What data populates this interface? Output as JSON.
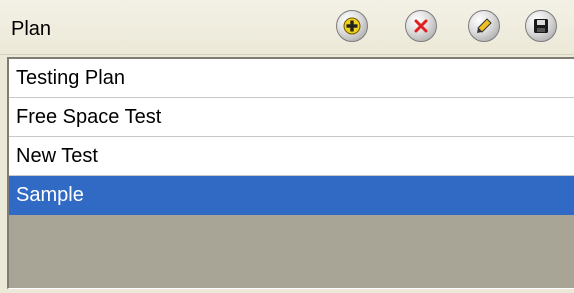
{
  "panel": {
    "title": "Plan",
    "toolbar": [
      {
        "name": "add-button",
        "icon": "plus-icon"
      },
      {
        "name": "delete-button",
        "icon": "x-icon"
      },
      {
        "name": "edit-button",
        "icon": "pencil-icon"
      },
      {
        "name": "save-button",
        "icon": "floppy-disk-icon"
      }
    ]
  },
  "plans": {
    "items": [
      {
        "label": "Testing Plan",
        "selected": false
      },
      {
        "label": "Free Space Test",
        "selected": false
      },
      {
        "label": "New Test",
        "selected": false
      },
      {
        "label": "Sample",
        "selected": true
      }
    ]
  },
  "colors": {
    "selection": "#316ac5",
    "list_background": "#a8a496",
    "panel_background": "#ece9d8"
  }
}
